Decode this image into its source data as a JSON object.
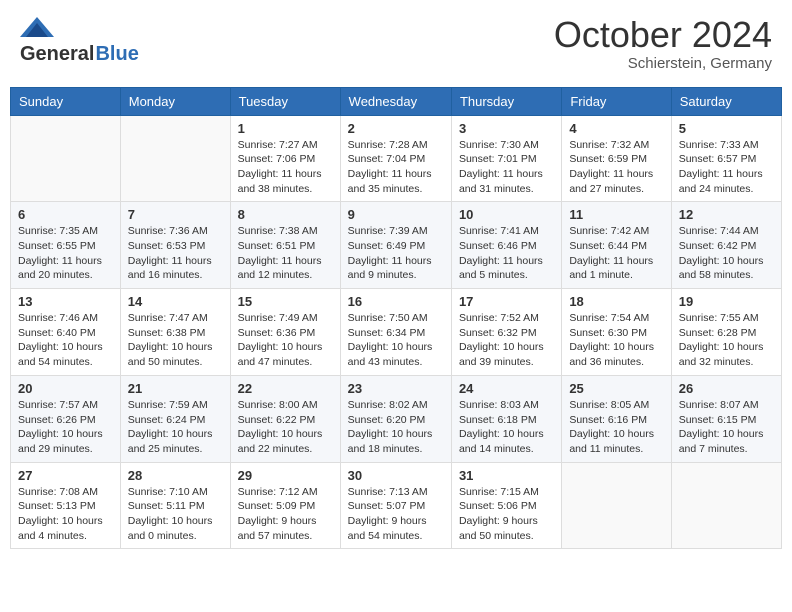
{
  "header": {
    "logo_general": "General",
    "logo_blue": "Blue",
    "month_title": "October 2024",
    "location": "Schierstein, Germany"
  },
  "days_of_week": [
    "Sunday",
    "Monday",
    "Tuesday",
    "Wednesday",
    "Thursday",
    "Friday",
    "Saturday"
  ],
  "weeks": [
    [
      {
        "day": "",
        "info": ""
      },
      {
        "day": "",
        "info": ""
      },
      {
        "day": "1",
        "info": "Sunrise: 7:27 AM\nSunset: 7:06 PM\nDaylight: 11 hours and 38 minutes."
      },
      {
        "day": "2",
        "info": "Sunrise: 7:28 AM\nSunset: 7:04 PM\nDaylight: 11 hours and 35 minutes."
      },
      {
        "day": "3",
        "info": "Sunrise: 7:30 AM\nSunset: 7:01 PM\nDaylight: 11 hours and 31 minutes."
      },
      {
        "day": "4",
        "info": "Sunrise: 7:32 AM\nSunset: 6:59 PM\nDaylight: 11 hours and 27 minutes."
      },
      {
        "day": "5",
        "info": "Sunrise: 7:33 AM\nSunset: 6:57 PM\nDaylight: 11 hours and 24 minutes."
      }
    ],
    [
      {
        "day": "6",
        "info": "Sunrise: 7:35 AM\nSunset: 6:55 PM\nDaylight: 11 hours and 20 minutes."
      },
      {
        "day": "7",
        "info": "Sunrise: 7:36 AM\nSunset: 6:53 PM\nDaylight: 11 hours and 16 minutes."
      },
      {
        "day": "8",
        "info": "Sunrise: 7:38 AM\nSunset: 6:51 PM\nDaylight: 11 hours and 12 minutes."
      },
      {
        "day": "9",
        "info": "Sunrise: 7:39 AM\nSunset: 6:49 PM\nDaylight: 11 hours and 9 minutes."
      },
      {
        "day": "10",
        "info": "Sunrise: 7:41 AM\nSunset: 6:46 PM\nDaylight: 11 hours and 5 minutes."
      },
      {
        "day": "11",
        "info": "Sunrise: 7:42 AM\nSunset: 6:44 PM\nDaylight: 11 hours and 1 minute."
      },
      {
        "day": "12",
        "info": "Sunrise: 7:44 AM\nSunset: 6:42 PM\nDaylight: 10 hours and 58 minutes."
      }
    ],
    [
      {
        "day": "13",
        "info": "Sunrise: 7:46 AM\nSunset: 6:40 PM\nDaylight: 10 hours and 54 minutes."
      },
      {
        "day": "14",
        "info": "Sunrise: 7:47 AM\nSunset: 6:38 PM\nDaylight: 10 hours and 50 minutes."
      },
      {
        "day": "15",
        "info": "Sunrise: 7:49 AM\nSunset: 6:36 PM\nDaylight: 10 hours and 47 minutes."
      },
      {
        "day": "16",
        "info": "Sunrise: 7:50 AM\nSunset: 6:34 PM\nDaylight: 10 hours and 43 minutes."
      },
      {
        "day": "17",
        "info": "Sunrise: 7:52 AM\nSunset: 6:32 PM\nDaylight: 10 hours and 39 minutes."
      },
      {
        "day": "18",
        "info": "Sunrise: 7:54 AM\nSunset: 6:30 PM\nDaylight: 10 hours and 36 minutes."
      },
      {
        "day": "19",
        "info": "Sunrise: 7:55 AM\nSunset: 6:28 PM\nDaylight: 10 hours and 32 minutes."
      }
    ],
    [
      {
        "day": "20",
        "info": "Sunrise: 7:57 AM\nSunset: 6:26 PM\nDaylight: 10 hours and 29 minutes."
      },
      {
        "day": "21",
        "info": "Sunrise: 7:59 AM\nSunset: 6:24 PM\nDaylight: 10 hours and 25 minutes."
      },
      {
        "day": "22",
        "info": "Sunrise: 8:00 AM\nSunset: 6:22 PM\nDaylight: 10 hours and 22 minutes."
      },
      {
        "day": "23",
        "info": "Sunrise: 8:02 AM\nSunset: 6:20 PM\nDaylight: 10 hours and 18 minutes."
      },
      {
        "day": "24",
        "info": "Sunrise: 8:03 AM\nSunset: 6:18 PM\nDaylight: 10 hours and 14 minutes."
      },
      {
        "day": "25",
        "info": "Sunrise: 8:05 AM\nSunset: 6:16 PM\nDaylight: 10 hours and 11 minutes."
      },
      {
        "day": "26",
        "info": "Sunrise: 8:07 AM\nSunset: 6:15 PM\nDaylight: 10 hours and 7 minutes."
      }
    ],
    [
      {
        "day": "27",
        "info": "Sunrise: 7:08 AM\nSunset: 5:13 PM\nDaylight: 10 hours and 4 minutes."
      },
      {
        "day": "28",
        "info": "Sunrise: 7:10 AM\nSunset: 5:11 PM\nDaylight: 10 hours and 0 minutes."
      },
      {
        "day": "29",
        "info": "Sunrise: 7:12 AM\nSunset: 5:09 PM\nDaylight: 9 hours and 57 minutes."
      },
      {
        "day": "30",
        "info": "Sunrise: 7:13 AM\nSunset: 5:07 PM\nDaylight: 9 hours and 54 minutes."
      },
      {
        "day": "31",
        "info": "Sunrise: 7:15 AM\nSunset: 5:06 PM\nDaylight: 9 hours and 50 minutes."
      },
      {
        "day": "",
        "info": ""
      },
      {
        "day": "",
        "info": ""
      }
    ]
  ]
}
